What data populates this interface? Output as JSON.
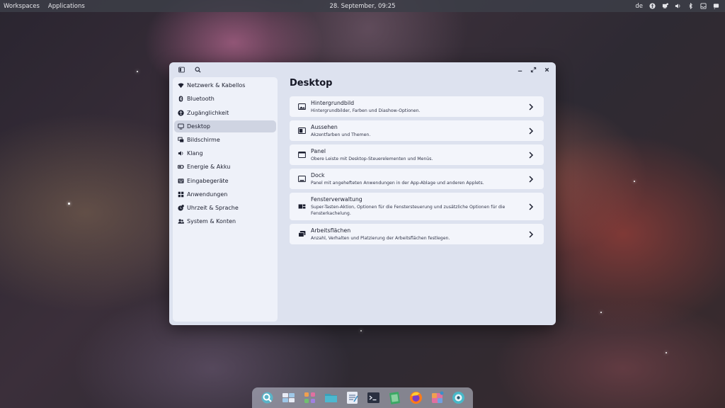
{
  "topbar": {
    "workspaces": "Workspaces",
    "applications": "Applications",
    "clock": "28. September, 09:25",
    "keyboard_layout": "de",
    "tray_icons": [
      "accessibility-icon",
      "network-icon",
      "audio-icon",
      "bluetooth-icon",
      "notifications-icon",
      "power-icon"
    ]
  },
  "window": {
    "titlebar_icons": [
      "sidebar-toggle-icon",
      "search-icon",
      "minimize-icon",
      "maximize-icon",
      "close-icon"
    ]
  },
  "sidebar": {
    "items": [
      {
        "label": "Netzwerk & Kabellos",
        "icon": "wifi-icon"
      },
      {
        "label": "Bluetooth",
        "icon": "bluetooth-icon"
      },
      {
        "label": "Zugänglichkeit",
        "icon": "accessibility-icon"
      },
      {
        "label": "Desktop",
        "icon": "desktop-icon",
        "active": true
      },
      {
        "label": "Bildschirme",
        "icon": "displays-icon"
      },
      {
        "label": "Klang",
        "icon": "sound-icon"
      },
      {
        "label": "Energie & Akku",
        "icon": "battery-icon"
      },
      {
        "label": "Eingabegeräte",
        "icon": "keyboard-icon"
      },
      {
        "label": "Anwendungen",
        "icon": "apps-icon"
      },
      {
        "label": "Uhrzeit & Sprache",
        "icon": "time-language-icon"
      },
      {
        "label": "System & Konten",
        "icon": "users-icon"
      }
    ]
  },
  "content": {
    "title": "Desktop",
    "cards": [
      {
        "title": "Hintergrundbild",
        "description": "Hintergrundbilder, Farben und Diashow-Optionen.",
        "icon": "wallpaper-icon"
      },
      {
        "title": "Aussehen",
        "description": "Akzentfarben und Themen.",
        "icon": "appearance-icon"
      },
      {
        "title": "Panel",
        "description": "Obere Leiste mit Desktop-Steuerelementen und Menüs.",
        "icon": "panel-icon"
      },
      {
        "title": "Dock",
        "description": "Panel mit angehefteten Anwendungen in der App-Ablage und anderen Applets.",
        "icon": "dock-icon"
      },
      {
        "title": "Fensterverwaltung",
        "description": "Super-Tasten-Aktion, Optionen für die Fenstersteuerung und zusätzliche Optionen für die Fensterkachelung.",
        "icon": "window-management-icon"
      },
      {
        "title": "Arbeitsflächen",
        "description": "Anzahl, Verhalten und Platzierung der Arbeitsflächen festlegen.",
        "icon": "workspaces-icon"
      }
    ]
  },
  "dock": {
    "apps": [
      "launcher-icon",
      "workspaces-app-icon",
      "app-library-icon",
      "files-icon",
      "text-editor-icon",
      "terminal-icon",
      "store-icon",
      "firefox-icon",
      "store-updates-icon",
      "settings-icon"
    ]
  },
  "colors": {
    "window_bg": "#dde2ef",
    "sidebar_bg": "#eef1f9",
    "card_bg": "#f3f5fb",
    "active_item": "#cfd4e2",
    "text": "#1d2030"
  }
}
